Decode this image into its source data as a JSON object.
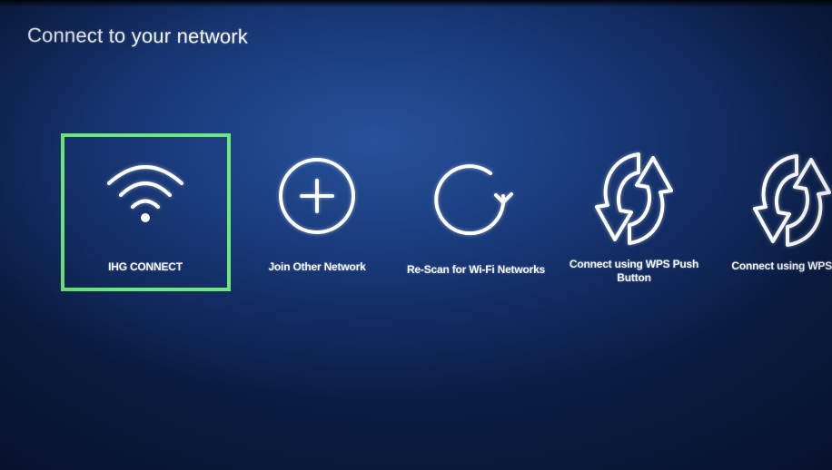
{
  "screen": {
    "title": "Connect to your network"
  },
  "options": [
    {
      "id": "ihg-connect",
      "label": "IHG CONNECT",
      "icon": "wifi-icon",
      "focused": true
    },
    {
      "id": "join-other",
      "label": "Join Other Network",
      "icon": "plus-circle-icon",
      "focused": false
    },
    {
      "id": "rescan",
      "label": "Re-Scan for Wi-Fi Networks",
      "icon": "refresh-icon",
      "focused": false
    },
    {
      "id": "wps-push",
      "label": "Connect using WPS Push Button",
      "icon": "wps-icon",
      "focused": false
    },
    {
      "id": "wps-pin",
      "label": "Connect using WPS PIN",
      "icon": "wps-icon",
      "focused": false
    }
  ],
  "colors": {
    "focus": "#6ee87a",
    "background": "#1c3f82",
    "text": "#ffffff"
  }
}
